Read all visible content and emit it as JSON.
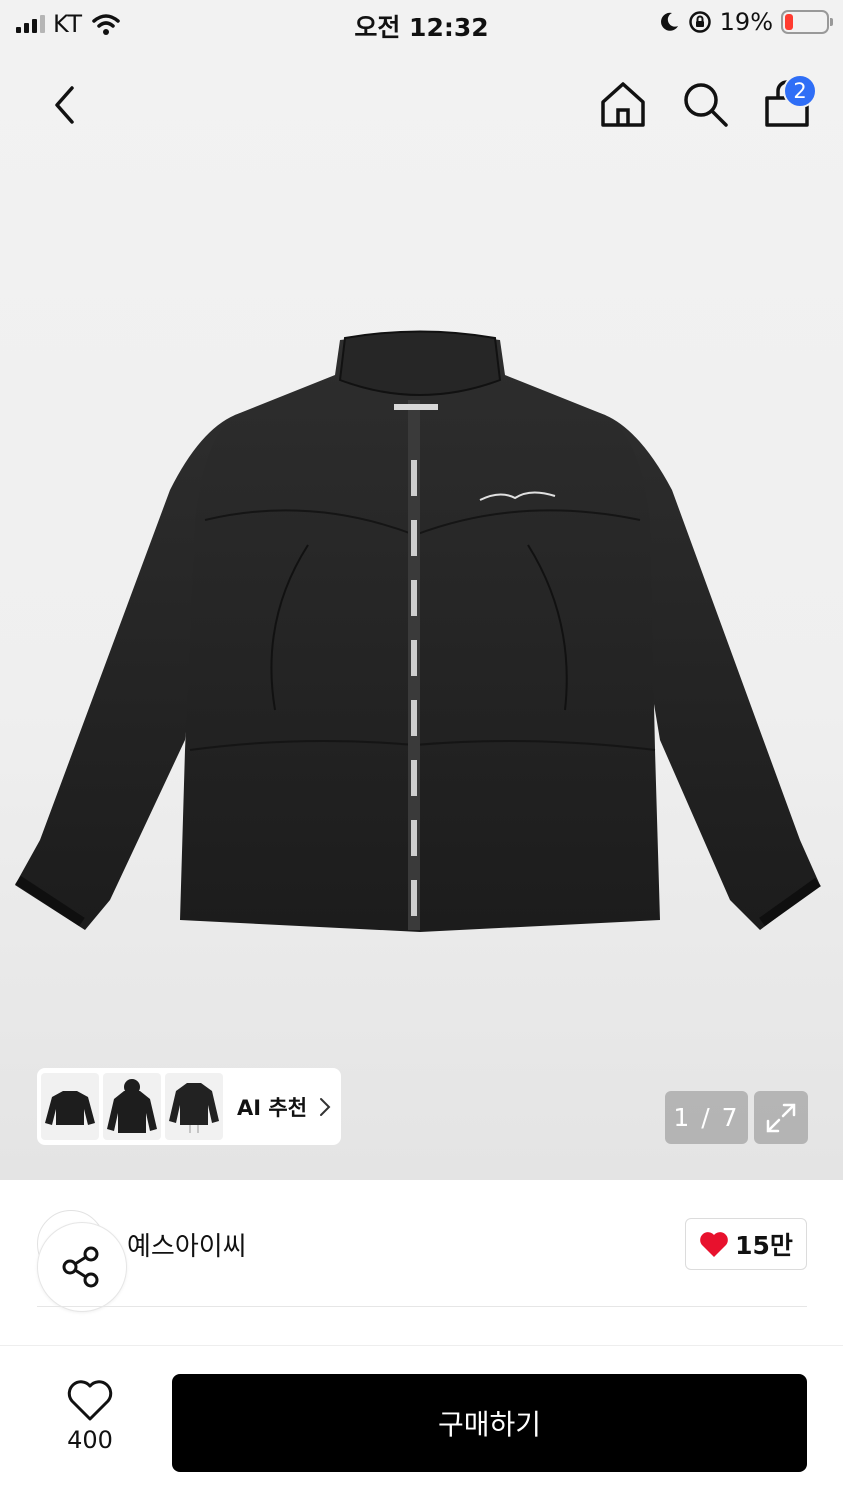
{
  "status_bar": {
    "carrier": "KT",
    "time": "오전 12:32",
    "battery_percent": "19%",
    "battery_level": 0.19,
    "icons": [
      "signal-icon",
      "wifi-icon",
      "moon-icon",
      "rotation-lock-icon",
      "battery-icon"
    ]
  },
  "nav": {
    "icons": [
      "back-icon",
      "home-icon",
      "search-icon",
      "cart-icon"
    ],
    "cart_badge": "2"
  },
  "gallery": {
    "ai_recommend_label": "AI 추천",
    "page_counter": "1 / 7"
  },
  "brand": {
    "name": "예스아이씨",
    "like_count": "15만"
  },
  "bottom_bar": {
    "wish_count": "400",
    "buy_label": "구매하기"
  },
  "colors": {
    "accent_badge": "#2f6ef6",
    "heart": "#e8112d",
    "buy_button": "#000000",
    "battery_low": "#ff3b30"
  }
}
